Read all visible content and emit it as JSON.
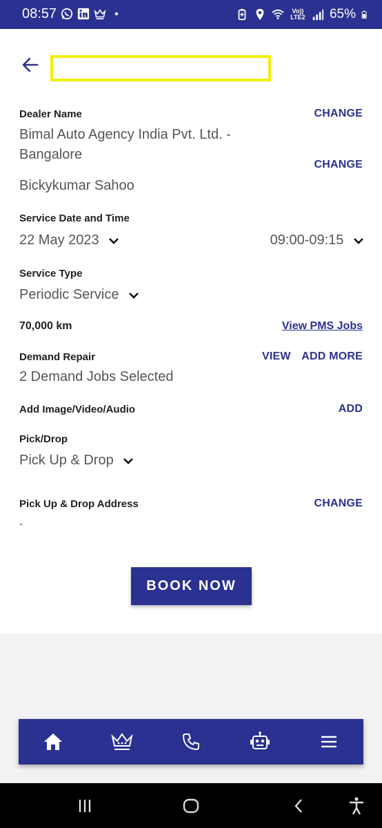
{
  "status_bar": {
    "time": "08:57",
    "network": "Vo)) LTE2",
    "battery": "65%",
    "icons": [
      "whatsapp-icon",
      "linkedin-icon",
      "crown-icon",
      "dot-icon",
      "battery-saver-icon",
      "location-icon",
      "wifi-icon",
      "signal-icon",
      "battery-icon"
    ]
  },
  "header": {
    "title": ""
  },
  "dealer": {
    "label": "Dealer Name",
    "change_label": "CHANGE",
    "name_line1": "Bimal Auto Agency India Pvt. Ltd. -",
    "name_line2": "Bangalore",
    "advisor": "Bickykumar Sahoo",
    "advisor_change_label": "CHANGE"
  },
  "service_datetime": {
    "label": "Service Date and Time",
    "date": "22 May 2023",
    "time_slot": "09:00-09:15"
  },
  "service_type": {
    "label": "Service Type",
    "value": "Periodic Service"
  },
  "odometer": {
    "value": "70,000 km",
    "link_label": "View PMS Jobs"
  },
  "demand_repair": {
    "label": "Demand Repair",
    "view_label": "VIEW",
    "add_more_label": "ADD MORE",
    "value": "2 Demand Jobs Selected"
  },
  "media": {
    "label": "Add Image/Video/Audio",
    "add_label": "ADD"
  },
  "pick_drop": {
    "label": "Pick/Drop",
    "value": "Pick Up & Drop"
  },
  "address": {
    "label": "Pick Up & Drop Address",
    "change_label": "CHANGE",
    "value": "-"
  },
  "book_button": "BOOK NOW",
  "bottom_nav": {
    "items": [
      "home-icon",
      "crown-icon",
      "phone-icon",
      "robot-icon",
      "menu-icon"
    ]
  },
  "system_nav": {
    "items": [
      "recents-icon",
      "home-circle-icon",
      "back-icon",
      "accessibility-icon"
    ]
  },
  "colors": {
    "primary": "#2b3190",
    "highlight_box": "#f2ee0a",
    "value_text": "#555555",
    "background_gray": "#f2f2f4"
  }
}
